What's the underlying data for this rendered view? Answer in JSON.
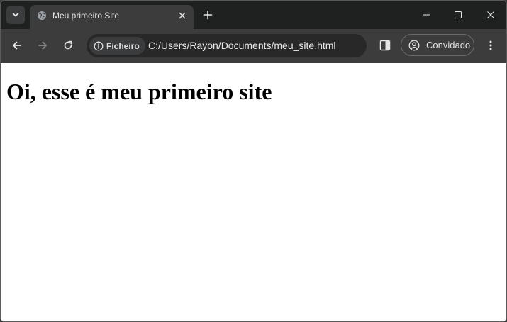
{
  "tab": {
    "title": "Meu primeiro Site",
    "favicon": "globe-icon"
  },
  "window_controls": [
    "minimize-icon",
    "maximize-icon",
    "close-icon"
  ],
  "toolbar": {
    "security_chip_label": "Ficheiro",
    "url": "C:/Users/Rayon/Documents/meu_site.html",
    "profile_label": "Convidado"
  },
  "page": {
    "heading": "Oi, esse é meu primeiro site"
  },
  "colors": {
    "titlebar": "#1f2020",
    "toolbar": "#3c3c3c",
    "omnibox": "#282828",
    "page_background": "#ffffff"
  }
}
